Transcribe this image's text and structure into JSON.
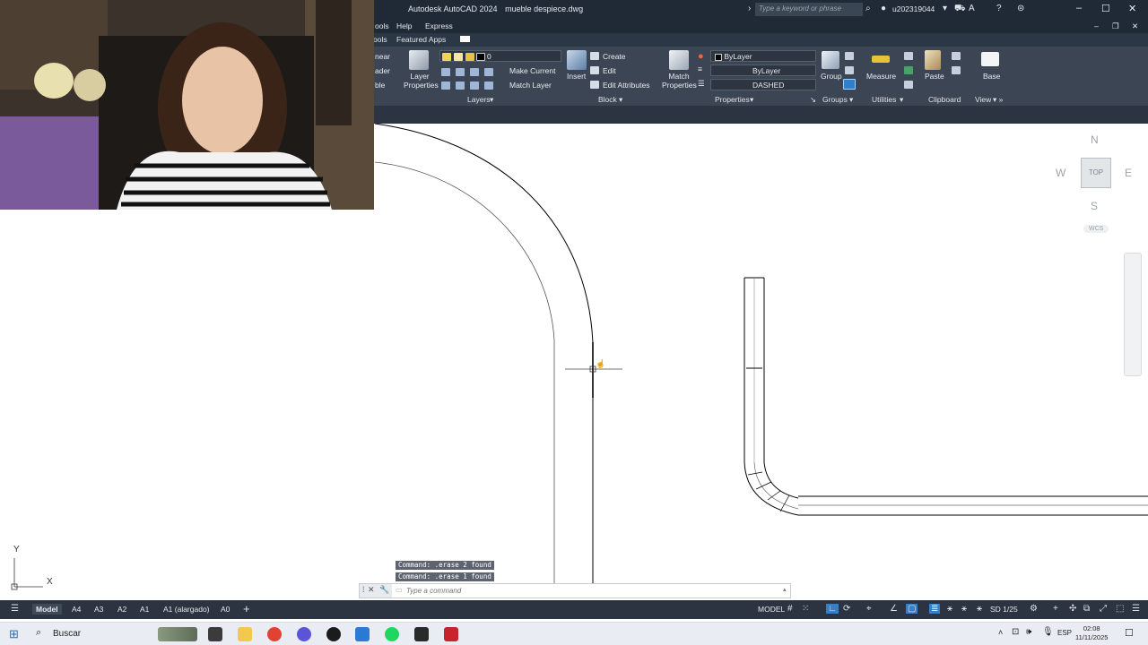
{
  "window": {
    "app_name": "Autodesk AutoCAD 2024",
    "file_name": "mueble despiece.dwg",
    "search_placeholder": "Type a keyword or phrase",
    "user": "u202319044"
  },
  "menu": {
    "items": [
      "ools",
      "Help",
      "Express"
    ],
    "partial_left": "ools"
  },
  "ribbon_tabs": [
    "ools",
    "Featured Apps"
  ],
  "ribbon": {
    "partial": [
      "near",
      "ader",
      "ble"
    ],
    "layers": {
      "button": "Layer Properties",
      "layer_value": "0",
      "make_current": "Make Current",
      "match_layer": "Match Layer",
      "title": "Layers"
    },
    "block": {
      "insert": "Insert",
      "create": "Create",
      "edit": "Edit",
      "edit_attributes": "Edit Attributes",
      "title": "Block"
    },
    "properties": {
      "match": "Match Properties",
      "color": "ByLayer",
      "lineweight": "ByLayer",
      "linetype": "DASHED",
      "title": "Properties"
    },
    "groups": {
      "group": "Group",
      "title": "Groups"
    },
    "utilities": {
      "measure": "Measure",
      "title": "Utilities"
    },
    "clipboard": {
      "paste": "Paste",
      "title": "Clipboard"
    },
    "view": {
      "base": "Base",
      "title": "View"
    }
  },
  "viewcube": {
    "north": "N",
    "south": "S",
    "east": "E",
    "west": "W",
    "face": "TOP",
    "wcs": "WCS"
  },
  "ucs": {
    "x": "X",
    "y": "Y"
  },
  "command": {
    "history": [
      "Command:  .erase 2 found",
      "Command:  .erase 1 found"
    ],
    "placeholder": "Type a command"
  },
  "layout_tabs": [
    "Model",
    "A4",
    "A3",
    "A2",
    "A1",
    "A1 (alargado)",
    "A0"
  ],
  "status": {
    "model": "MODEL",
    "scale": "SD 1/25"
  },
  "taskbar": {
    "search": "Buscar",
    "language": "ESP",
    "time": "02:08",
    "date": "11/11/2025"
  }
}
